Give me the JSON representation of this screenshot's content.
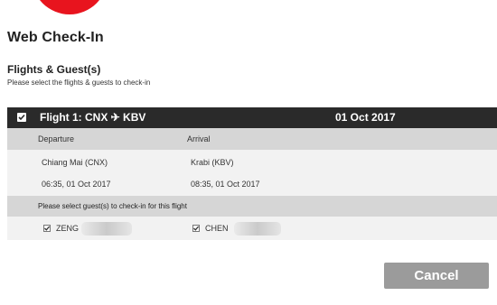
{
  "brand": {
    "logo_icon": "brand-logo-red-circle",
    "accent_color": "#e8141e"
  },
  "page": {
    "title": "Web Check-In"
  },
  "section": {
    "title": "Flights & Guest(s)",
    "subtitle": "Please select the flights & guests to check-in"
  },
  "flight": {
    "checked": true,
    "title": "Flight 1: CNX ✈ KBV",
    "date": "01 Oct 2017",
    "departure_header": "Departure",
    "arrival_header": "Arrival",
    "departure_place": "Chiang Mai (CNX)",
    "departure_time": "06:35, 01 Oct 2017",
    "arrival_place": "Krabi (KBV)",
    "arrival_time": "08:35, 01 Oct 2017",
    "guests_prompt": "Please select guest(s) to check-in for this flight",
    "guests": [
      {
        "name": "ZENG",
        "checked": true
      },
      {
        "name": "CHEN",
        "checked": true
      }
    ]
  },
  "actions": {
    "cancel_label": "Cancel"
  }
}
